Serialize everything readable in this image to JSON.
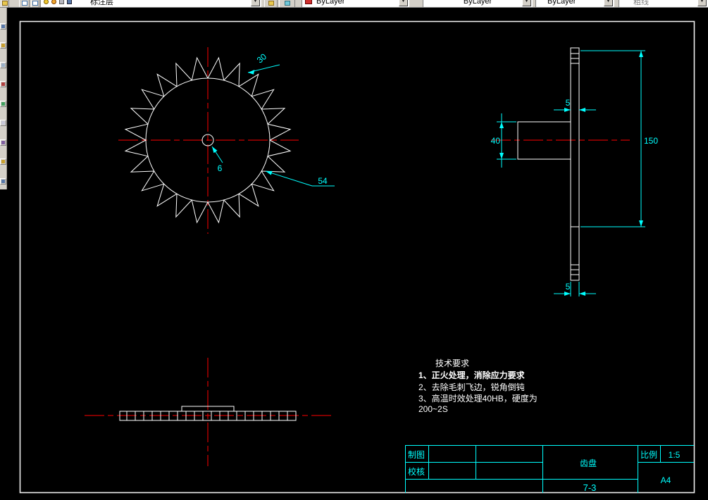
{
  "toolbar": {
    "layer_value": "标注层",
    "color_value": "ByLayer",
    "linetype_value": "ByLayer",
    "lineweight_value": "ByLayer",
    "plotstyle_value": "粗线",
    "dropdown_arrow": "▼"
  },
  "drawing": {
    "front_view": {
      "angle_dim": "30",
      "bore_dim": "6",
      "leader_dim": "54"
    },
    "side_view": {
      "thickness_top": "5",
      "hub_length": "40",
      "diameter": "150",
      "thickness_bottom": "5"
    },
    "tech_requirements": {
      "title": "技术要求",
      "line1": "1、正火处理，消除应力要求",
      "line2": "2、去除毛刺飞边，锐角倒钝",
      "line3": "3、高温时效处理40HB，硬度为",
      "line4": "200~2S"
    },
    "title_block": {
      "drawn_by_label": "制图",
      "checked_by_label": "校核",
      "part_name": "齿盘",
      "scale_label": "比例",
      "scale_value": "1:5",
      "sheet_size": "A4",
      "drawing_no": "7-3"
    }
  },
  "colors": {
    "background": "#000000",
    "outline": "#ffffff",
    "centerline": "#ff0000",
    "dimension": "#00ffff",
    "toolbar_bg": "#d4d0c8"
  }
}
